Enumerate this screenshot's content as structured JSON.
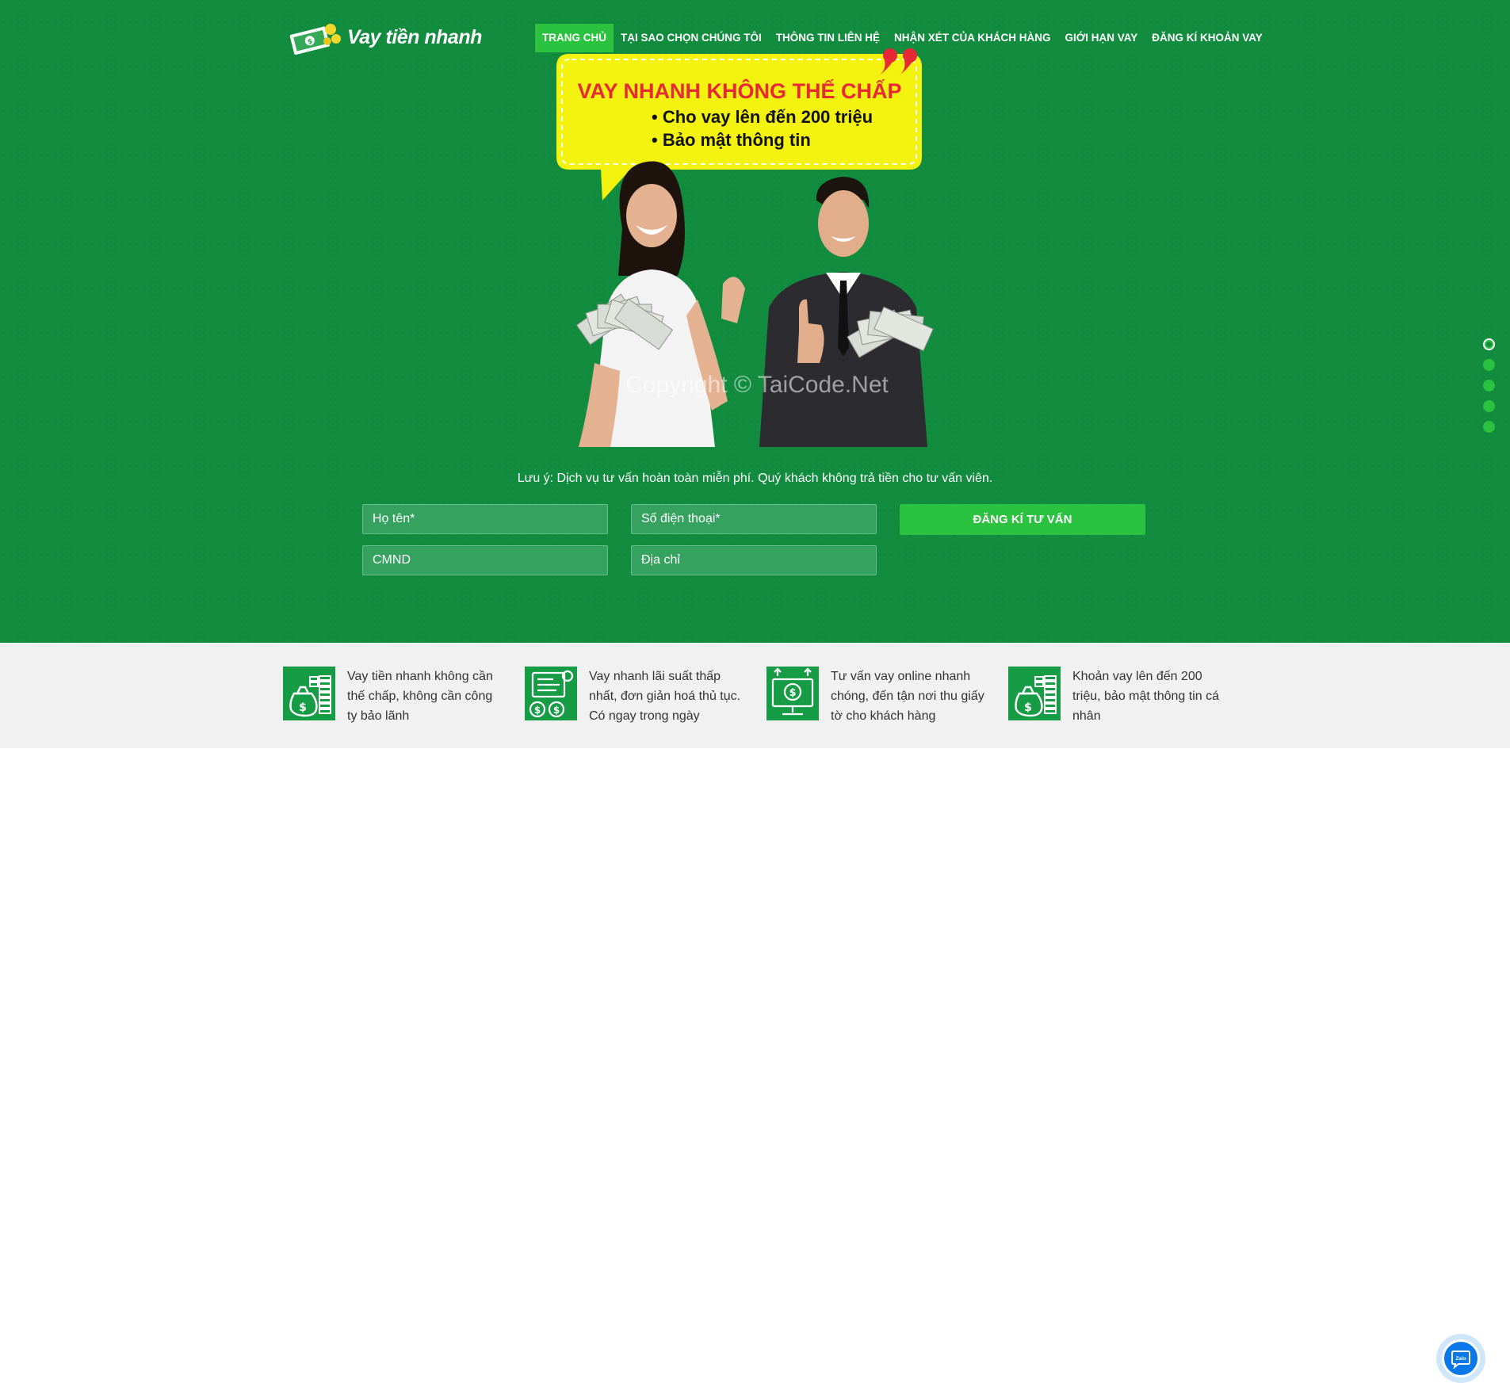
{
  "brand": {
    "name": "Vay tiền nhanh"
  },
  "nav": {
    "items": [
      {
        "label": "TRANG CHỦ",
        "active": true
      },
      {
        "label": "TẠI SAO CHỌN CHÚNG TÔI",
        "active": false
      },
      {
        "label": "THÔNG TIN LIÊN HỆ",
        "active": false
      },
      {
        "label": "NHẬN XÉT CỦA KHÁCH HÀNG",
        "active": false
      },
      {
        "label": "GIỚI HẠN VAY",
        "active": false
      },
      {
        "label": "ĐĂNG KÍ KHOẢN VAY",
        "active": false
      }
    ]
  },
  "banner": {
    "headline": "VAY NHANH KHÔNG THẾ CHẤP",
    "bullets": [
      "• Cho vay lên đến 200 triệu",
      "• Bảo mật thông tin"
    ],
    "watermark": "Copyright © TaiCode.Net"
  },
  "slider": {
    "count": 5,
    "active_index": 0
  },
  "form": {
    "note": "Lưu ý: Dịch vụ tư vấn hoàn toàn miễn phí. Quý khách không trả tiền cho tư vấn viên.",
    "name_placeholder": "Họ tên*",
    "phone_placeholder": "Số điện thoại*",
    "id_placeholder": "CMND",
    "address_placeholder": "Địa chỉ",
    "submit_label": "ĐĂNG KÍ TƯ VẤN"
  },
  "features": [
    {
      "icon": "money-bag-coins-icon",
      "text": "Vay tiền nhanh không cần thế chấp, không cần công ty bảo lãnh"
    },
    {
      "icon": "calculator-coins-icon",
      "text": "Vay nhanh lãi suất thấp nhất, đơn giản hoá thủ tục. Có ngay trong ngày"
    },
    {
      "icon": "online-monitor-dollar-icon",
      "text": "Tư vấn vay online nhanh chóng, đến tận nơi thu giấy tờ cho khách hàng"
    },
    {
      "icon": "money-bag-coins-icon",
      "text": "Khoản vay lên đến 200 triệu, bảo mật thông tin cá nhân"
    }
  ],
  "chat": {
    "label": "Zalo"
  },
  "colors": {
    "primary": "#118b3e",
    "accent": "#2bc23f",
    "banner_yellow": "#f4f20f",
    "headline_red": "#e62a35"
  }
}
